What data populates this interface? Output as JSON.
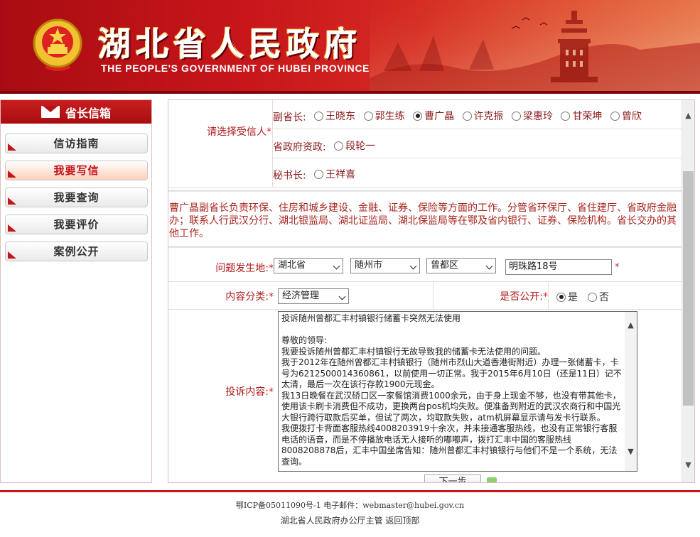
{
  "banner": {
    "title_cn": "湖北省人民政府",
    "title_en": "THE PEOPLE'S GOVERNMENT OF HUBEI PROVINCE"
  },
  "sidebar": {
    "header": "省长信箱",
    "items": [
      {
        "label": "信访指南",
        "active": false
      },
      {
        "label": "我要写信",
        "active": true
      },
      {
        "label": "我要查询",
        "active": false
      },
      {
        "label": "我要评价",
        "active": false
      },
      {
        "label": "案例公开",
        "active": false
      }
    ]
  },
  "recipient": {
    "label": "请选择受信人",
    "required_mark": "*",
    "group1_title": "副省长:",
    "group1": [
      "王晓东",
      "郭生练",
      "曹广晶",
      "许克振",
      "梁惠玲",
      "甘荣坤",
      "曾欣"
    ],
    "group1_selected": "曹广晶",
    "group2_title": "省政府资政:",
    "group2": [
      "段轮一"
    ],
    "group3_title": "秘书长:",
    "group3": [
      "王祥喜"
    ]
  },
  "description": "曹广晶副省长负责环保、住房和城乡建设、金融、证券、保险等方面的工作。分管省环保厅、省住建厅、省政府金融办；联系人行武汉分行、湖北银监局、湖北证监局、湖北保监局等在鄂及省内银行、证券、保险机构。省长交办的其他工作。",
  "location": {
    "label": "问题发生地:",
    "required_mark": "*",
    "province": "湖北省",
    "city": "随州市",
    "district": "曾都区",
    "address": "明珠路18号",
    "address_mark": "*"
  },
  "category": {
    "label": "内容分类:",
    "required_mark": "*",
    "value": "经济管理"
  },
  "public": {
    "label": "是否公开:",
    "required_mark": "*",
    "yes": "是",
    "no": "否",
    "selected": "是"
  },
  "complaint": {
    "label": "投诉内容:",
    "required_mark": "*",
    "text": "投诉随州曾都汇丰村镇银行储蓄卡突然无法使用\n\n尊敬的领导:\n我要投诉随州曾都汇丰村镇银行无故导致我的储蓄卡无法使用的问题。\n我于2012年在随州曾都汇丰村镇银行（随州市烈山大道香港街附近）办理一张储蓄卡，卡号为6212500014360861，以前使用一切正常。我于2015年6月10日（还是11日）记不太清，最后一次在该行存款1900元现金。\n我13日晚餐在武汉硚口区一家餐馆消费1000余元，由于身上现金不够，也没有带其他卡，使用该卡刷卡消费但不成功，更换两台pos机均失败。便准备到附近的武汉农商行和中国光大银行跨行取款后买单，但试了两次，均取款失败，atm机屏幕显示请与发卡行联系。\n我便拨打卡背面客服热线4008203919十余次，并未接通客服热线，也没有正常银行客服电话的语音，而是不停播放电话无人接听的嘟嘟声，拨打汇丰中国的客服热线8008208878后，汇丰中国坐席告知：随州曾都汇丰村镇银行与他们不是一个系统，无法查询。"
  },
  "submit_label": "下一步",
  "footer": {
    "line1": "鄂ICP备05011090号-1 电子邮件：webmaster@hubei.gov.cn",
    "line2": "湖北省人民政府办公厅主管  返回顶部"
  },
  "colors": {
    "brand_red": "#c8161b",
    "label_red": "#b01a1a"
  },
  "icons": [
    "national-emblem-icon",
    "mail-icon",
    "radio-icon",
    "chevron-down-icon",
    "scroll-up-icon",
    "scroll-down-icon"
  ]
}
